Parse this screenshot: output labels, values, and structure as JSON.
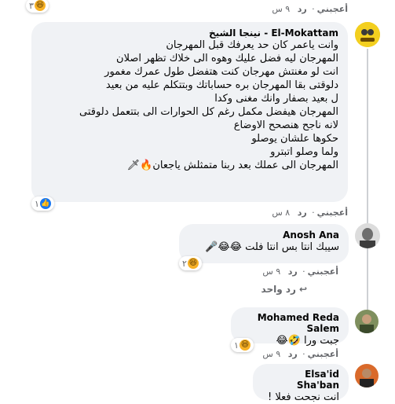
{
  "top_action": {
    "like": "أعجبني",
    "reply": "رد",
    "time": "٩ س",
    "reaction_count": "٣"
  },
  "comments": [
    {
      "author": "El-Mokattam - نينجا الشيخ",
      "lines": [
        "وانت ياعمر كان حد يعرفك قبل المهرجان",
        "المهرجان ليه فضل عليك وهوه الى خلاك تظهر اصلان",
        "انت لو مغنتش مهرجان كنت هتفضل طول عمرك مغمور",
        "دلوقتى بقا المهرجان بره حساباتك وبتتكلم عليه من بعيد",
        "ل بعيد بصفار وانك مغنى وكدا",
        "المهرجان هيفضل مكمل رغم كل الحوارات الى بتتعمل دلوقتى",
        "لانه ناجح هنصحح الاوضاع",
        "حكوها علشان يوصلو",
        "ولما وصلو اتبترو",
        "المهرجان الى عملك بعد ربنا متمثلش ياجعان🔥🗡"
      ],
      "reaction_count": "١",
      "actions": {
        "like": "أعجبني",
        "reply": "رد",
        "time": "٨ س"
      }
    },
    {
      "author": "Anosh Ana",
      "lines": [
        "سيبك انتا بس انتا فلت 😂😂🎤"
      ],
      "reaction_count": "٢",
      "actions": {
        "like": "أعجبني",
        "reply": "رد",
        "time": "٩ س"
      }
    },
    {
      "author": "Mohamed Reda Salem",
      "lines": [
        "جبت ورا 🤣😂"
      ],
      "reaction_count": "١",
      "actions": {
        "like": "أعجبني",
        "reply": "رد",
        "time": "٩ س"
      }
    },
    {
      "author": "Elsa'id Sha'ban",
      "lines": [
        "انت نجحت فعلا !"
      ]
    }
  ],
  "reply_link": "رد واحد",
  "colors": {
    "bubble": "#f0f2f5",
    "meta": "#65676b",
    "like_blue": "#1877f2",
    "haha_yellow": "#f7b125"
  }
}
